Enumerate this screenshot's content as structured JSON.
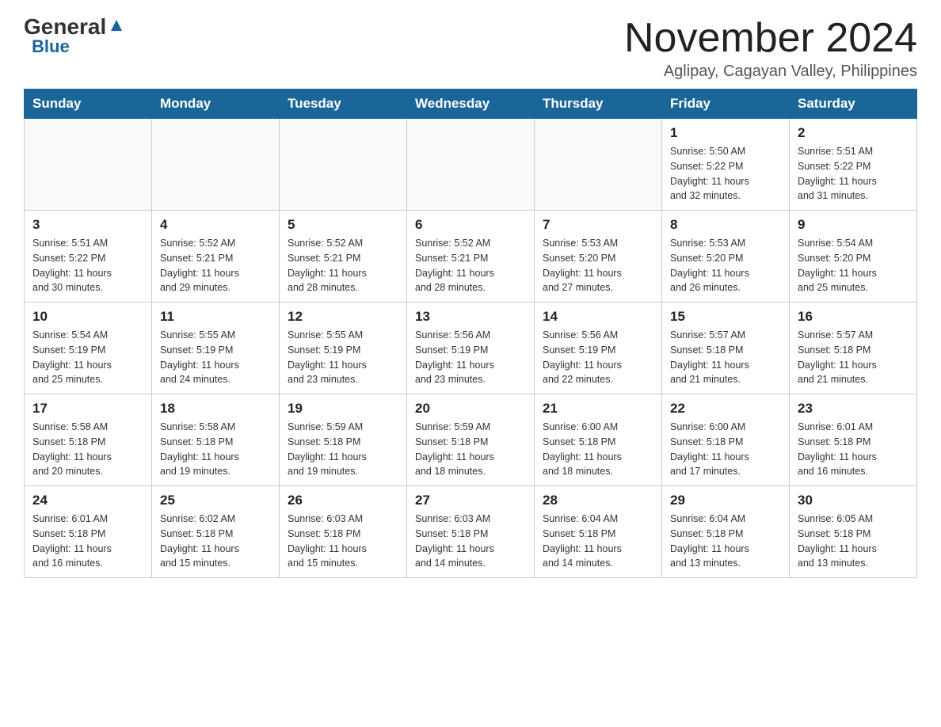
{
  "header": {
    "logo_general": "General",
    "logo_blue": "Blue",
    "month_year": "November 2024",
    "location": "Aglipay, Cagayan Valley, Philippines"
  },
  "weekdays": [
    "Sunday",
    "Monday",
    "Tuesday",
    "Wednesday",
    "Thursday",
    "Friday",
    "Saturday"
  ],
  "weeks": [
    [
      {
        "day": "",
        "info": ""
      },
      {
        "day": "",
        "info": ""
      },
      {
        "day": "",
        "info": ""
      },
      {
        "day": "",
        "info": ""
      },
      {
        "day": "",
        "info": ""
      },
      {
        "day": "1",
        "info": "Sunrise: 5:50 AM\nSunset: 5:22 PM\nDaylight: 11 hours\nand 32 minutes."
      },
      {
        "day": "2",
        "info": "Sunrise: 5:51 AM\nSunset: 5:22 PM\nDaylight: 11 hours\nand 31 minutes."
      }
    ],
    [
      {
        "day": "3",
        "info": "Sunrise: 5:51 AM\nSunset: 5:22 PM\nDaylight: 11 hours\nand 30 minutes."
      },
      {
        "day": "4",
        "info": "Sunrise: 5:52 AM\nSunset: 5:21 PM\nDaylight: 11 hours\nand 29 minutes."
      },
      {
        "day": "5",
        "info": "Sunrise: 5:52 AM\nSunset: 5:21 PM\nDaylight: 11 hours\nand 28 minutes."
      },
      {
        "day": "6",
        "info": "Sunrise: 5:52 AM\nSunset: 5:21 PM\nDaylight: 11 hours\nand 28 minutes."
      },
      {
        "day": "7",
        "info": "Sunrise: 5:53 AM\nSunset: 5:20 PM\nDaylight: 11 hours\nand 27 minutes."
      },
      {
        "day": "8",
        "info": "Sunrise: 5:53 AM\nSunset: 5:20 PM\nDaylight: 11 hours\nand 26 minutes."
      },
      {
        "day": "9",
        "info": "Sunrise: 5:54 AM\nSunset: 5:20 PM\nDaylight: 11 hours\nand 25 minutes."
      }
    ],
    [
      {
        "day": "10",
        "info": "Sunrise: 5:54 AM\nSunset: 5:19 PM\nDaylight: 11 hours\nand 25 minutes."
      },
      {
        "day": "11",
        "info": "Sunrise: 5:55 AM\nSunset: 5:19 PM\nDaylight: 11 hours\nand 24 minutes."
      },
      {
        "day": "12",
        "info": "Sunrise: 5:55 AM\nSunset: 5:19 PM\nDaylight: 11 hours\nand 23 minutes."
      },
      {
        "day": "13",
        "info": "Sunrise: 5:56 AM\nSunset: 5:19 PM\nDaylight: 11 hours\nand 23 minutes."
      },
      {
        "day": "14",
        "info": "Sunrise: 5:56 AM\nSunset: 5:19 PM\nDaylight: 11 hours\nand 22 minutes."
      },
      {
        "day": "15",
        "info": "Sunrise: 5:57 AM\nSunset: 5:18 PM\nDaylight: 11 hours\nand 21 minutes."
      },
      {
        "day": "16",
        "info": "Sunrise: 5:57 AM\nSunset: 5:18 PM\nDaylight: 11 hours\nand 21 minutes."
      }
    ],
    [
      {
        "day": "17",
        "info": "Sunrise: 5:58 AM\nSunset: 5:18 PM\nDaylight: 11 hours\nand 20 minutes."
      },
      {
        "day": "18",
        "info": "Sunrise: 5:58 AM\nSunset: 5:18 PM\nDaylight: 11 hours\nand 19 minutes."
      },
      {
        "day": "19",
        "info": "Sunrise: 5:59 AM\nSunset: 5:18 PM\nDaylight: 11 hours\nand 19 minutes."
      },
      {
        "day": "20",
        "info": "Sunrise: 5:59 AM\nSunset: 5:18 PM\nDaylight: 11 hours\nand 18 minutes."
      },
      {
        "day": "21",
        "info": "Sunrise: 6:00 AM\nSunset: 5:18 PM\nDaylight: 11 hours\nand 18 minutes."
      },
      {
        "day": "22",
        "info": "Sunrise: 6:00 AM\nSunset: 5:18 PM\nDaylight: 11 hours\nand 17 minutes."
      },
      {
        "day": "23",
        "info": "Sunrise: 6:01 AM\nSunset: 5:18 PM\nDaylight: 11 hours\nand 16 minutes."
      }
    ],
    [
      {
        "day": "24",
        "info": "Sunrise: 6:01 AM\nSunset: 5:18 PM\nDaylight: 11 hours\nand 16 minutes."
      },
      {
        "day": "25",
        "info": "Sunrise: 6:02 AM\nSunset: 5:18 PM\nDaylight: 11 hours\nand 15 minutes."
      },
      {
        "day": "26",
        "info": "Sunrise: 6:03 AM\nSunset: 5:18 PM\nDaylight: 11 hours\nand 15 minutes."
      },
      {
        "day": "27",
        "info": "Sunrise: 6:03 AM\nSunset: 5:18 PM\nDaylight: 11 hours\nand 14 minutes."
      },
      {
        "day": "28",
        "info": "Sunrise: 6:04 AM\nSunset: 5:18 PM\nDaylight: 11 hours\nand 14 minutes."
      },
      {
        "day": "29",
        "info": "Sunrise: 6:04 AM\nSunset: 5:18 PM\nDaylight: 11 hours\nand 13 minutes."
      },
      {
        "day": "30",
        "info": "Sunrise: 6:05 AM\nSunset: 5:18 PM\nDaylight: 11 hours\nand 13 minutes."
      }
    ]
  ]
}
